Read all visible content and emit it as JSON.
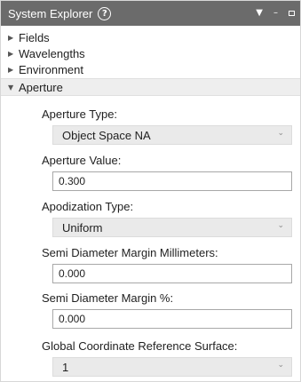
{
  "window": {
    "title": "System Explorer",
    "help_glyph": "?",
    "controls": {
      "dropdown_glyph": "▼",
      "minimize_glyph": "–"
    }
  },
  "tree": {
    "items": [
      {
        "label": "Fields",
        "expanded": false
      },
      {
        "label": "Wavelengths",
        "expanded": false
      },
      {
        "label": "Environment",
        "expanded": false
      },
      {
        "label": "Aperture",
        "expanded": true
      }
    ],
    "collapsed_arrow": "▶",
    "expanded_arrow": "▼"
  },
  "aperture": {
    "aperture_type": {
      "label": "Aperture Type:",
      "value": "Object Space NA"
    },
    "aperture_value": {
      "label": "Aperture Value:",
      "value": "0.300"
    },
    "apodization_type": {
      "label": "Apodization Type:",
      "value": "Uniform"
    },
    "sd_margin_mm": {
      "label": "Semi Diameter Margin Millimeters:",
      "value": "0.000"
    },
    "sd_margin_pct": {
      "label": "Semi Diameter Margin %:",
      "value": "0.000"
    },
    "global_ref_surface": {
      "label": "Global Coordinate Reference Surface:",
      "value": "1"
    }
  },
  "chevron_glyph": "⌄"
}
